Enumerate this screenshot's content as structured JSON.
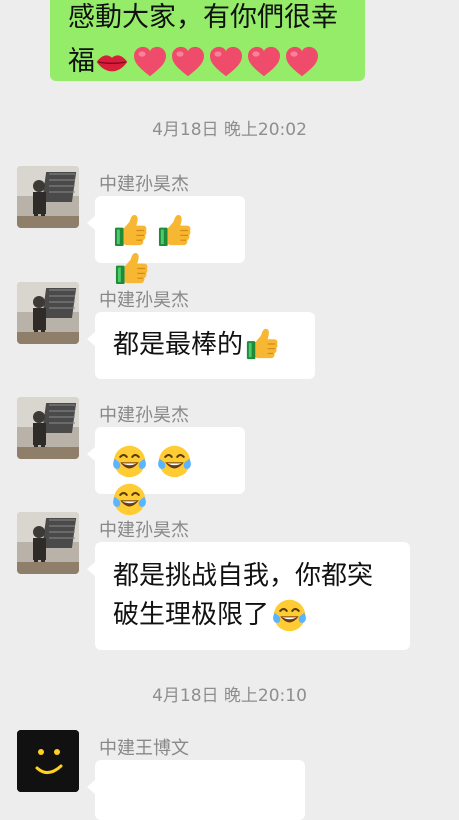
{
  "top_message": {
    "line1": "感動大家，有你們很幸",
    "line2": "福"
  },
  "timestamps": [
    "4月18日 晚上20:02",
    "4月18日 晚上20:10"
  ],
  "messages": [
    {
      "sender": "中建孙昊杰",
      "text": ""
    },
    {
      "sender": "中建孙昊杰",
      "text": "都是最棒的"
    },
    {
      "sender": "中建孙昊杰",
      "text": ""
    },
    {
      "sender": "中建孙昊杰",
      "text": "都是挑战自我，你都突",
      "text2": "破生理极限了"
    },
    {
      "sender": "中建王博文",
      "text": ""
    }
  ],
  "icons": {
    "lips": "lips-icon",
    "heart": "red-heart-icon",
    "thumb": "thumbs-up-icon",
    "joy": "tears-of-joy-icon"
  },
  "colors": {
    "background": "#ededed",
    "outgoing_bubble": "#95ec69",
    "incoming_bubble": "#ffffff",
    "meta_text": "#8e8e8e"
  }
}
